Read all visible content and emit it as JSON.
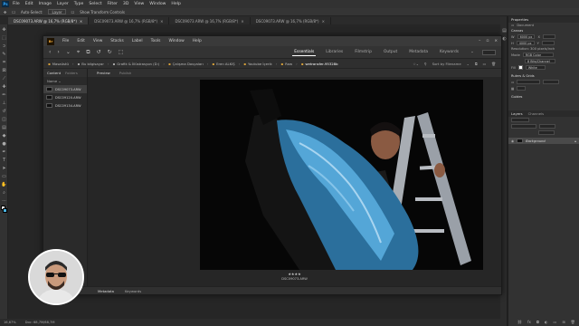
{
  "ps": {
    "logo": "Ps",
    "menu": [
      "File",
      "Edit",
      "Image",
      "Layer",
      "Type",
      "Select",
      "Filter",
      "3D",
      "View",
      "Window",
      "Help"
    ],
    "options": {
      "auto_select": "Auto-Select:",
      "layer": "Layer",
      "transform": "Show Transform Controls"
    },
    "tabs": [
      {
        "label": "DSC09073.ARW @ 16,7% (RGB/8*)"
      },
      {
        "label": "DSC09073.ARW @ 16,7% (RGB/8*)"
      },
      {
        "label": "DSC09073.ARW @ 16,7% (RGB/8*)"
      },
      {
        "label": "DSC09073.ARW @ 16,7% (RGB/8*)"
      }
    ],
    "status": {
      "zoom": "16,67%",
      "doc": "Doc: 68,7M/68,7M"
    },
    "properties": {
      "title": "Properties",
      "document": "Document",
      "canvas": "Canvas",
      "w": "6000 px",
      "h": "4000 px",
      "resolution": "Resolution: 300 pixels/inch",
      "mode_label": "Mode",
      "mode": "RGB Color",
      "depth": "8 Bits/Channel",
      "fill_label": "Fill",
      "fill": "White",
      "rulers": "Rulers & Grids",
      "guides": "Guides"
    },
    "layers": {
      "tab1": "Layers",
      "tab2": "Channels",
      "layer_name": "Background"
    }
  },
  "bridge": {
    "logo": "Br",
    "menu": [
      "File",
      "Edit",
      "View",
      "Stacks",
      "Label",
      "Tools",
      "Window",
      "Help"
    ],
    "workspaces": [
      "Essentials",
      "Libraries",
      "Filmstrip",
      "Output",
      "Metadata",
      "Keywords"
    ],
    "path": [
      "Masaüstü",
      "Bu bilgisayar",
      "Grafik & İllüstrasyon (D:)",
      "Çalışma Dosyaları",
      "Eren ALKIŞ",
      "Youtube İçerik",
      "Raw",
      "wetransfer-95328b"
    ],
    "sort": "Sort by Filename",
    "left_tabs": {
      "content": "Content",
      "folders": "Folders"
    },
    "column": "Name",
    "files": [
      "DSC09073.ARW",
      "DSC09120.ARW",
      "DSC09134.ARW"
    ],
    "preview_tabs": {
      "preview": "Preview",
      "publish": "Publish"
    },
    "rating": "★★★★",
    "current_file": "DSC09073.ARW",
    "bottom_tabs": {
      "metadata": "Metadata",
      "keywords": "Keywords"
    }
  }
}
